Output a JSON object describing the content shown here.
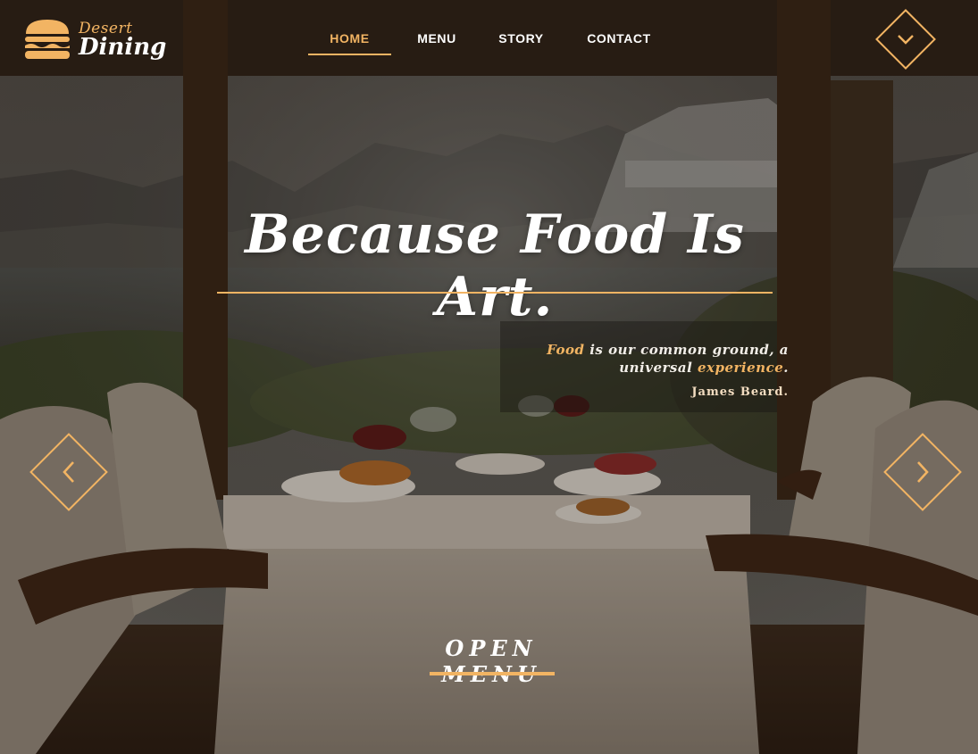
{
  "brand": {
    "line1": "Desert",
    "line2": "Dining",
    "accent_color": "#f2b463"
  },
  "nav": {
    "items": [
      {
        "label": "HOME",
        "active": true
      },
      {
        "label": "MENU",
        "active": false
      },
      {
        "label": "STORY",
        "active": false
      },
      {
        "label": "CONTACT",
        "active": false
      }
    ]
  },
  "icons": {
    "menu_toggle": "chevron-down-icon",
    "prev_slide": "chevron-left-icon",
    "next_slide": "chevron-right-icon",
    "logo": "burger-icon"
  },
  "hero": {
    "headline": "Because Food Is Art.",
    "quote": {
      "part1": "Food",
      "part2": " is our common ground, a universal ",
      "part3": "experience",
      "part4": ".",
      "author": "James Beard."
    },
    "cta_label": "OPEN MENU"
  }
}
